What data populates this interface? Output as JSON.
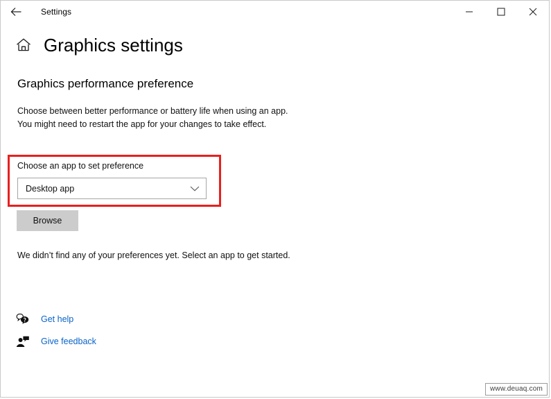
{
  "window": {
    "titlebar_title": "Settings",
    "back_icon": "arrow-left-icon",
    "controls": {
      "minimize": "minimize-icon",
      "maximize": "maximize-icon",
      "close": "close-icon"
    }
  },
  "header": {
    "home_icon": "home-icon",
    "page_title": "Graphics settings"
  },
  "main": {
    "section_title": "Graphics performance preference",
    "description_line1": "Choose between better performance or battery life when using an app.",
    "description_line2": "You might need to restart the app for your changes to take effect.",
    "preference": {
      "field_label": "Choose an app to set preference",
      "dropdown_value": "Desktop app",
      "dropdown_icon": "chevron-down-icon",
      "highlight_color": "#e8201e"
    },
    "browse_label": "Browse",
    "status_text": "We didn’t find any of your preferences yet. Select an app to get started."
  },
  "footer": {
    "link_color": "#0a63c9",
    "links": [
      {
        "label": "Get help",
        "icon": "help-bubble-icon"
      },
      {
        "label": "Give feedback",
        "icon": "feedback-person-icon"
      }
    ]
  },
  "watermark": {
    "text": "www.deuaq.com"
  }
}
